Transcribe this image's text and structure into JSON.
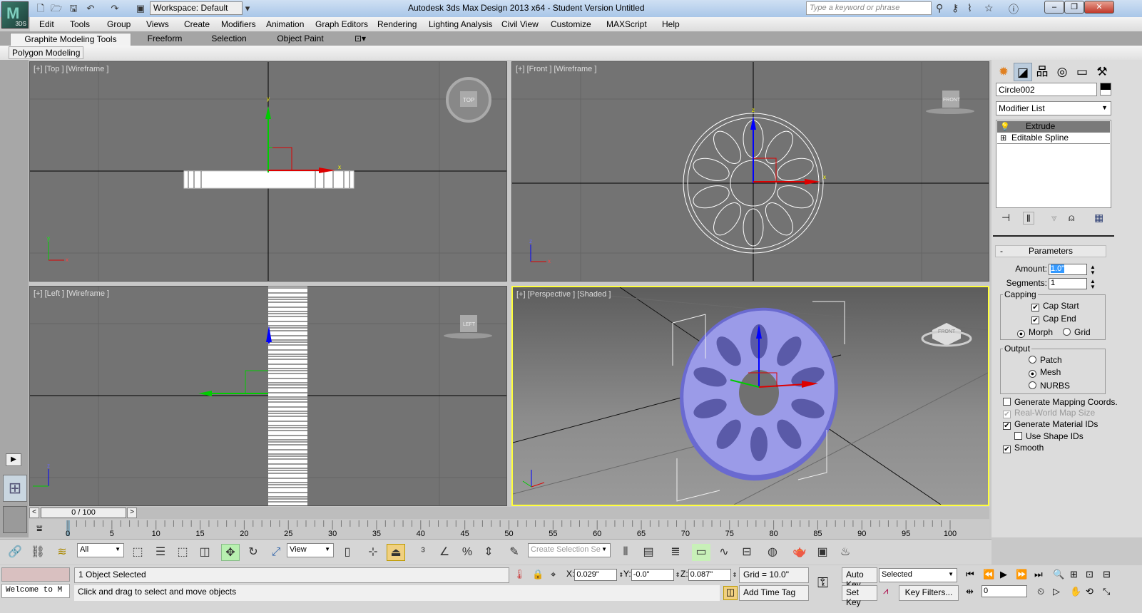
{
  "app": {
    "title": "Autodesk 3ds Max Design 2013 x64  -  Student Version    Untitled",
    "logo_text": "3DS",
    "workspace": "Workspace: Default",
    "search_placeholder": "Type a keyword or phrase"
  },
  "menu": [
    "Edit",
    "Tools",
    "Group",
    "Views",
    "Create",
    "Modifiers",
    "Animation",
    "Graph Editors",
    "Rendering",
    "Lighting Analysis",
    "Civil View",
    "Customize",
    "MAXScript",
    "Help"
  ],
  "ribbon": {
    "tabs": [
      "Graphite Modeling Tools",
      "Freeform",
      "Selection",
      "Object Paint"
    ],
    "panel": "Polygon Modeling"
  },
  "viewports": {
    "top": {
      "label": "[+] [Top ] [Wireframe ]",
      "cube": "TOP"
    },
    "front": {
      "label": "[+] [Front ] [Wireframe ]",
      "cube": "FRONT"
    },
    "left": {
      "label": "[+] [Left ] [Wireframe ]",
      "cube": "LEFT"
    },
    "perspective": {
      "label": "[+] [Perspective ] [Shaded ]",
      "cube": "FRONT"
    }
  },
  "command_panel": {
    "object_name": "Circle002",
    "modifier_list": "Modifier List",
    "stack": [
      "Extrude",
      "Editable Spline"
    ],
    "rollout": {
      "title": "Parameters",
      "collapse": "-",
      "amount_label": "Amount:",
      "amount": "1.0\"",
      "segments_label": "Segments:",
      "segments": "1",
      "capping": {
        "title": "Capping",
        "cap_start": "Cap Start",
        "cap_end": "Cap End",
        "morph": "Morph",
        "grid": "Grid"
      },
      "output": {
        "title": "Output",
        "patch": "Patch",
        "mesh": "Mesh",
        "nurbs": "NURBS"
      },
      "gen_mapping": "Generate Mapping Coords.",
      "real_world": "Real-World Map Size",
      "gen_matids": "Generate Material IDs",
      "use_shape_ids": "Use Shape IDs",
      "smooth": "Smooth"
    }
  },
  "timeline": {
    "frame": "0 / 100",
    "ticks": [
      "0",
      "5",
      "10",
      "15",
      "20",
      "25",
      "30",
      "35",
      "40",
      "45",
      "50",
      "55",
      "60",
      "65",
      "70",
      "75",
      "80",
      "85",
      "90",
      "95",
      "100"
    ]
  },
  "toolbar": {
    "filter": "All",
    "ref_coord": "View",
    "selection_set": "Create Selection Se"
  },
  "status": {
    "selected": "1 Object Selected",
    "prompt": "Click and drag to select and move objects",
    "listener": "Welcome to M",
    "x_label": "X:",
    "x": "0.029\"",
    "y_label": "Y:",
    "y": "-0.0\"",
    "z_label": "Z:",
    "z": "0.087\"",
    "grid": "Grid = 10.0\"",
    "add_time_tag": "Add Time Tag",
    "auto_key": "Auto Key",
    "set_key": "Set Key",
    "key_mode": "Selected",
    "key_filters": "Key Filters...",
    "current_frame": "0"
  }
}
